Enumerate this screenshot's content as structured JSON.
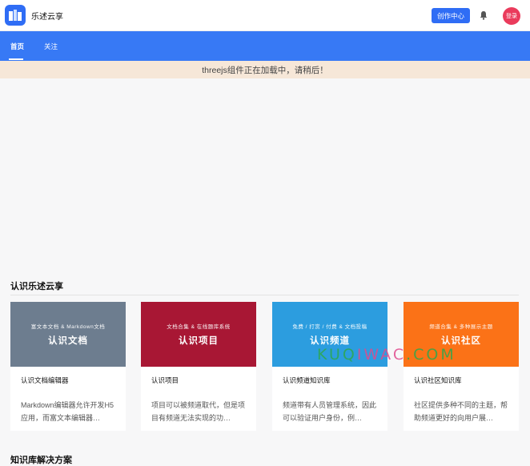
{
  "header": {
    "brand": "乐述云享",
    "create_label": "创作中心",
    "login_label": "登录"
  },
  "nav": {
    "tabs": [
      {
        "label": "首页",
        "active": true
      },
      {
        "label": "关注",
        "active": false
      }
    ]
  },
  "notice": "threejs组件正在加载中，请稍后！",
  "section1": {
    "title": "认识乐述云享",
    "cards": [
      {
        "banner_sub": "富文本文档 & Markdown文档",
        "banner_title": "认识文档",
        "title": "认识文档编辑器",
        "desc": "Markdown编辑器允许开发H5应用，而富文本编辑器…",
        "color": "#6d7d8f"
      },
      {
        "banner_sub": "文档合集 & 在线题库系统",
        "banner_title": "认识项目",
        "title": "认识项目",
        "desc": "项目可以被频道取代，但是项目有频道无法实现的功…",
        "color": "#a81734"
      },
      {
        "banner_sub": "免费 / 打赏 / 付费 & 文档投稿",
        "banner_title": "认识频道",
        "title": "认识频道知识库",
        "desc": "频道带有人员管理系统，因此可以验证用户身份，例…",
        "color": "#2c9ddf"
      },
      {
        "banner_sub": "频道合集 & 多种展示主题",
        "banner_title": "认识社区",
        "title": "认识社区知识库",
        "desc": "社区提供多种不同的主题，帮助频道更好的向用户展…",
        "color": "#fb7217"
      }
    ]
  },
  "section2": {
    "title": "知识库解决方案"
  },
  "watermark": {
    "part1": "KUQ",
    "part2": "IWAC",
    "part3": ".COM"
  }
}
